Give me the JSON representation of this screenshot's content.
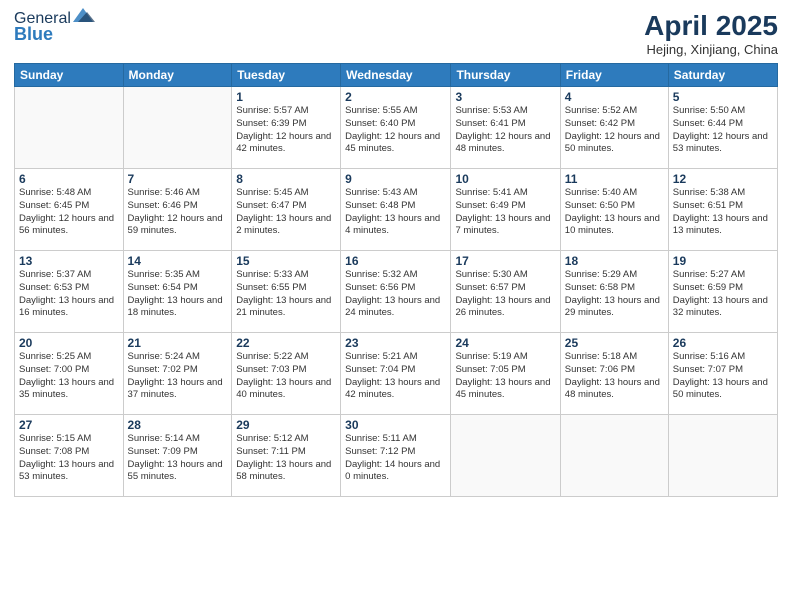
{
  "header": {
    "logo_general": "General",
    "logo_blue": "Blue",
    "title": "April 2025",
    "location": "Hejing, Xinjiang, China"
  },
  "weekdays": [
    "Sunday",
    "Monday",
    "Tuesday",
    "Wednesday",
    "Thursday",
    "Friday",
    "Saturday"
  ],
  "weeks": [
    [
      {
        "day": "",
        "info": ""
      },
      {
        "day": "",
        "info": ""
      },
      {
        "day": "1",
        "info": "Sunrise: 5:57 AM\nSunset: 6:39 PM\nDaylight: 12 hours and 42 minutes."
      },
      {
        "day": "2",
        "info": "Sunrise: 5:55 AM\nSunset: 6:40 PM\nDaylight: 12 hours and 45 minutes."
      },
      {
        "day": "3",
        "info": "Sunrise: 5:53 AM\nSunset: 6:41 PM\nDaylight: 12 hours and 48 minutes."
      },
      {
        "day": "4",
        "info": "Sunrise: 5:52 AM\nSunset: 6:42 PM\nDaylight: 12 hours and 50 minutes."
      },
      {
        "day": "5",
        "info": "Sunrise: 5:50 AM\nSunset: 6:44 PM\nDaylight: 12 hours and 53 minutes."
      }
    ],
    [
      {
        "day": "6",
        "info": "Sunrise: 5:48 AM\nSunset: 6:45 PM\nDaylight: 12 hours and 56 minutes."
      },
      {
        "day": "7",
        "info": "Sunrise: 5:46 AM\nSunset: 6:46 PM\nDaylight: 12 hours and 59 minutes."
      },
      {
        "day": "8",
        "info": "Sunrise: 5:45 AM\nSunset: 6:47 PM\nDaylight: 13 hours and 2 minutes."
      },
      {
        "day": "9",
        "info": "Sunrise: 5:43 AM\nSunset: 6:48 PM\nDaylight: 13 hours and 4 minutes."
      },
      {
        "day": "10",
        "info": "Sunrise: 5:41 AM\nSunset: 6:49 PM\nDaylight: 13 hours and 7 minutes."
      },
      {
        "day": "11",
        "info": "Sunrise: 5:40 AM\nSunset: 6:50 PM\nDaylight: 13 hours and 10 minutes."
      },
      {
        "day": "12",
        "info": "Sunrise: 5:38 AM\nSunset: 6:51 PM\nDaylight: 13 hours and 13 minutes."
      }
    ],
    [
      {
        "day": "13",
        "info": "Sunrise: 5:37 AM\nSunset: 6:53 PM\nDaylight: 13 hours and 16 minutes."
      },
      {
        "day": "14",
        "info": "Sunrise: 5:35 AM\nSunset: 6:54 PM\nDaylight: 13 hours and 18 minutes."
      },
      {
        "day": "15",
        "info": "Sunrise: 5:33 AM\nSunset: 6:55 PM\nDaylight: 13 hours and 21 minutes."
      },
      {
        "day": "16",
        "info": "Sunrise: 5:32 AM\nSunset: 6:56 PM\nDaylight: 13 hours and 24 minutes."
      },
      {
        "day": "17",
        "info": "Sunrise: 5:30 AM\nSunset: 6:57 PM\nDaylight: 13 hours and 26 minutes."
      },
      {
        "day": "18",
        "info": "Sunrise: 5:29 AM\nSunset: 6:58 PM\nDaylight: 13 hours and 29 minutes."
      },
      {
        "day": "19",
        "info": "Sunrise: 5:27 AM\nSunset: 6:59 PM\nDaylight: 13 hours and 32 minutes."
      }
    ],
    [
      {
        "day": "20",
        "info": "Sunrise: 5:25 AM\nSunset: 7:00 PM\nDaylight: 13 hours and 35 minutes."
      },
      {
        "day": "21",
        "info": "Sunrise: 5:24 AM\nSunset: 7:02 PM\nDaylight: 13 hours and 37 minutes."
      },
      {
        "day": "22",
        "info": "Sunrise: 5:22 AM\nSunset: 7:03 PM\nDaylight: 13 hours and 40 minutes."
      },
      {
        "day": "23",
        "info": "Sunrise: 5:21 AM\nSunset: 7:04 PM\nDaylight: 13 hours and 42 minutes."
      },
      {
        "day": "24",
        "info": "Sunrise: 5:19 AM\nSunset: 7:05 PM\nDaylight: 13 hours and 45 minutes."
      },
      {
        "day": "25",
        "info": "Sunrise: 5:18 AM\nSunset: 7:06 PM\nDaylight: 13 hours and 48 minutes."
      },
      {
        "day": "26",
        "info": "Sunrise: 5:16 AM\nSunset: 7:07 PM\nDaylight: 13 hours and 50 minutes."
      }
    ],
    [
      {
        "day": "27",
        "info": "Sunrise: 5:15 AM\nSunset: 7:08 PM\nDaylight: 13 hours and 53 minutes."
      },
      {
        "day": "28",
        "info": "Sunrise: 5:14 AM\nSunset: 7:09 PM\nDaylight: 13 hours and 55 minutes."
      },
      {
        "day": "29",
        "info": "Sunrise: 5:12 AM\nSunset: 7:11 PM\nDaylight: 13 hours and 58 minutes."
      },
      {
        "day": "30",
        "info": "Sunrise: 5:11 AM\nSunset: 7:12 PM\nDaylight: 14 hours and 0 minutes."
      },
      {
        "day": "",
        "info": ""
      },
      {
        "day": "",
        "info": ""
      },
      {
        "day": "",
        "info": ""
      }
    ]
  ]
}
